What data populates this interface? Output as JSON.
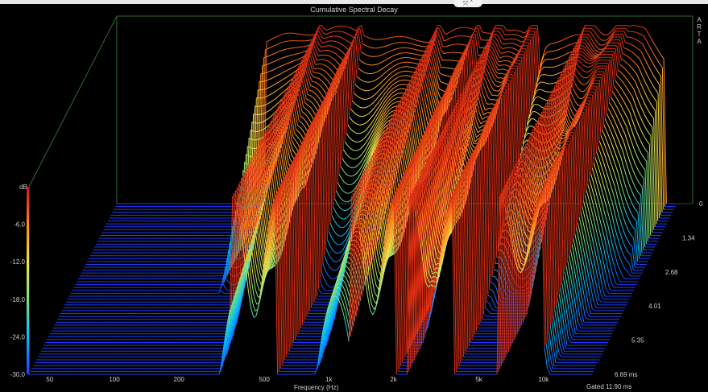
{
  "window": {
    "tab_glyphs": "⤧ ⌃"
  },
  "chart_data": {
    "type": "waterfall",
    "title": "Cumulative Spectral Decay",
    "brand": "ARTA",
    "xlabel": "Frequency (Hz)",
    "x_scale": "log",
    "x_ticks": [
      "50",
      "100",
      "200",
      "500",
      "1k",
      "2k",
      "5k",
      "10k"
    ],
    "x_tick_values": [
      50,
      100,
      200,
      500,
      1000,
      2000,
      5000,
      10000
    ],
    "xlim": [
      40,
      20000
    ],
    "y_unit": "dB",
    "y_ticks": [
      "-6.0",
      "-12.0",
      "-18.0",
      "-24.0",
      "-30.0"
    ],
    "y_tick_values": [
      -6,
      -12,
      -18,
      -24,
      -30
    ],
    "ylim": [
      -30,
      0
    ],
    "z_ticks": [
      "0",
      "1.34",
      "2.68",
      "4.01",
      "5.35",
      "6.69 ms"
    ],
    "z_tick_values": [
      0,
      1.34,
      2.68,
      4.01,
      5.35,
      6.69
    ],
    "zlim_ms": [
      0,
      6.69
    ],
    "slice_count": 60,
    "gated": "Gated 11.90 ms",
    "colormap": [
      "#1c3dff",
      "#00bfff",
      "#7ee27a",
      "#f2e24a",
      "#ff8a1c",
      "#d61010"
    ],
    "grid_color": "#2f6a2f",
    "passband_hz": [
      200,
      15000
    ],
    "response_peaks": [
      {
        "freq_hz": 3000,
        "level_db": -4,
        "decay_ms": 3.2
      },
      {
        "freq_hz": 7800,
        "level_db": -2,
        "decay_ms": 4.0
      },
      {
        "freq_hz": 450,
        "level_db": -12,
        "decay_ms": 5.2
      },
      {
        "freq_hz": 1600,
        "level_db": -10,
        "decay_ms": 4.6
      }
    ]
  }
}
